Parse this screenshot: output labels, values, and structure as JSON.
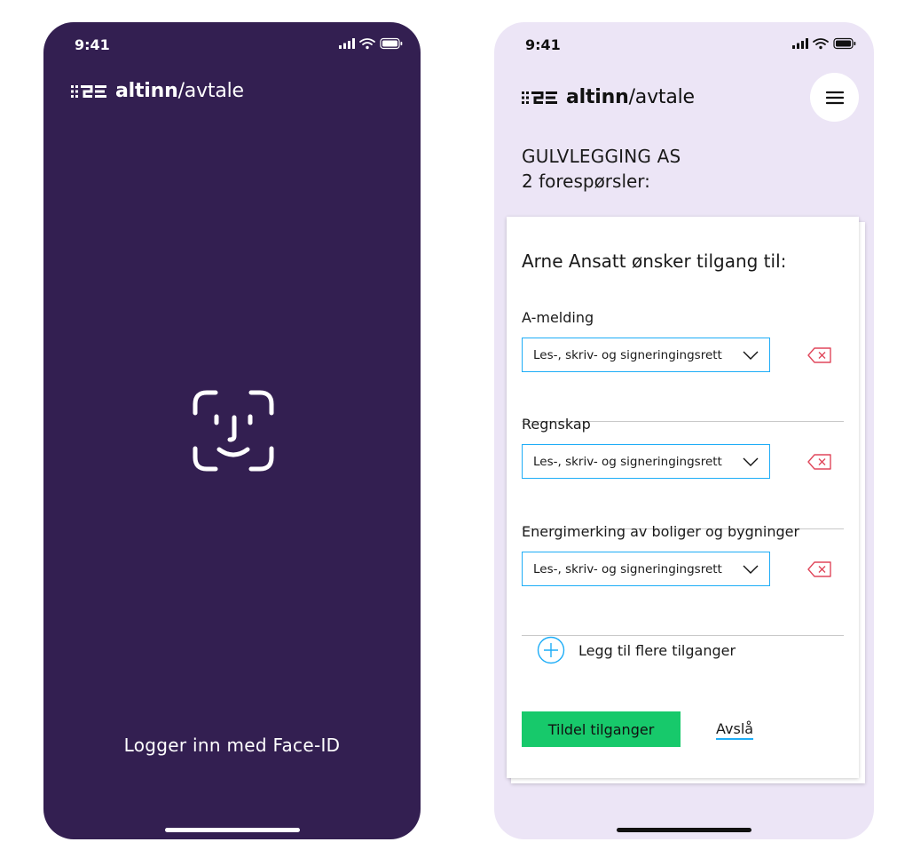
{
  "left_phone": {
    "status_time": "9:41",
    "logo": {
      "brand": "altinn",
      "product": "avtale"
    },
    "icon": "face-id-icon",
    "login_text": "Logger inn med Face-ID"
  },
  "right_phone": {
    "status_time": "9:41",
    "logo": {
      "brand": "altinn",
      "product": "avtale"
    },
    "menu_icon": "hamburger-menu-icon",
    "company": "GULVLEGGING AS",
    "requests": "2 forespørsler:",
    "card": {
      "title": "Arne Ansatt ønsker tilgang til:",
      "permissions": [
        {
          "label": "A-melding",
          "selected": "Les-, skriv- og signeringingsrett"
        },
        {
          "label": "Regnskap",
          "selected": "Les-, skriv- og signeringingsrett"
        },
        {
          "label": "Energimerking av boliger og bygninger",
          "selected": "Les-, skriv- og signeringingsrett"
        }
      ],
      "add_more": "Legg til flere tilganger",
      "grant_button": "Tildel tilganger",
      "decline_link": "Avslå"
    }
  },
  "colors": {
    "left_background": "#331f51",
    "right_background": "#ece5f6",
    "accent_blue": "#1eadf7",
    "grant_green": "#17c96b",
    "delete_red": "#e0475b"
  }
}
